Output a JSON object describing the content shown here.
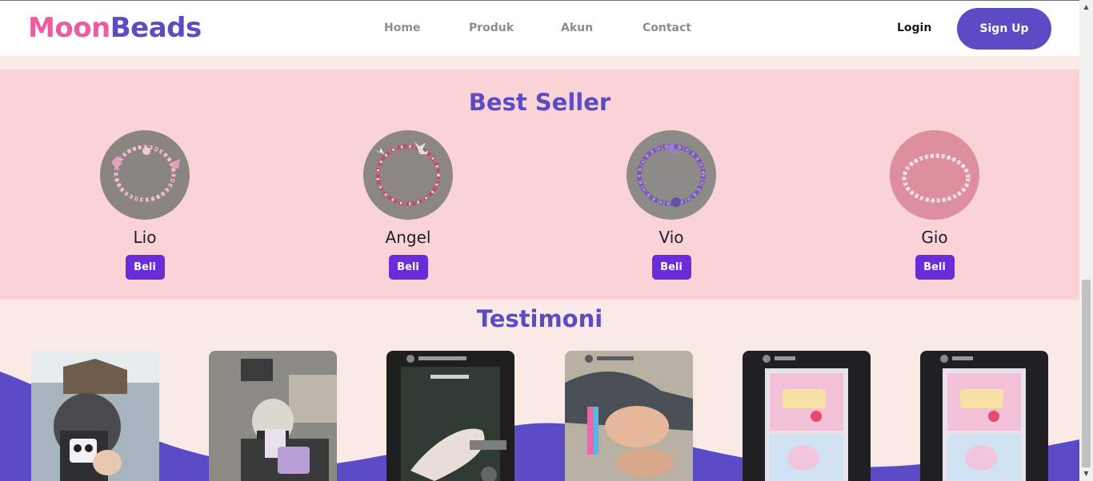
{
  "brand": {
    "part1": "Moon",
    "part2": "Beads"
  },
  "nav": {
    "home": "Home",
    "produk": "Produk",
    "akun": "Akun",
    "contact": "Contact"
  },
  "auth": {
    "login": "Login",
    "signup": "Sign Up"
  },
  "best_seller": {
    "title": "Best Seller",
    "items": [
      {
        "name": "Lio",
        "button": "Beli"
      },
      {
        "name": "Angel",
        "button": "Beli"
      },
      {
        "name": "Vio",
        "button": "Beli"
      },
      {
        "name": "Gio",
        "button": "Beli"
      }
    ]
  },
  "testimoni": {
    "title": "Testimoni"
  },
  "colors": {
    "brand_pink": "#ef5aa0",
    "brand_purple": "#5b4bc4",
    "button_purple": "#6a2bd8",
    "section_pink": "#f9d3d6",
    "page_bg": "#faeae6"
  }
}
